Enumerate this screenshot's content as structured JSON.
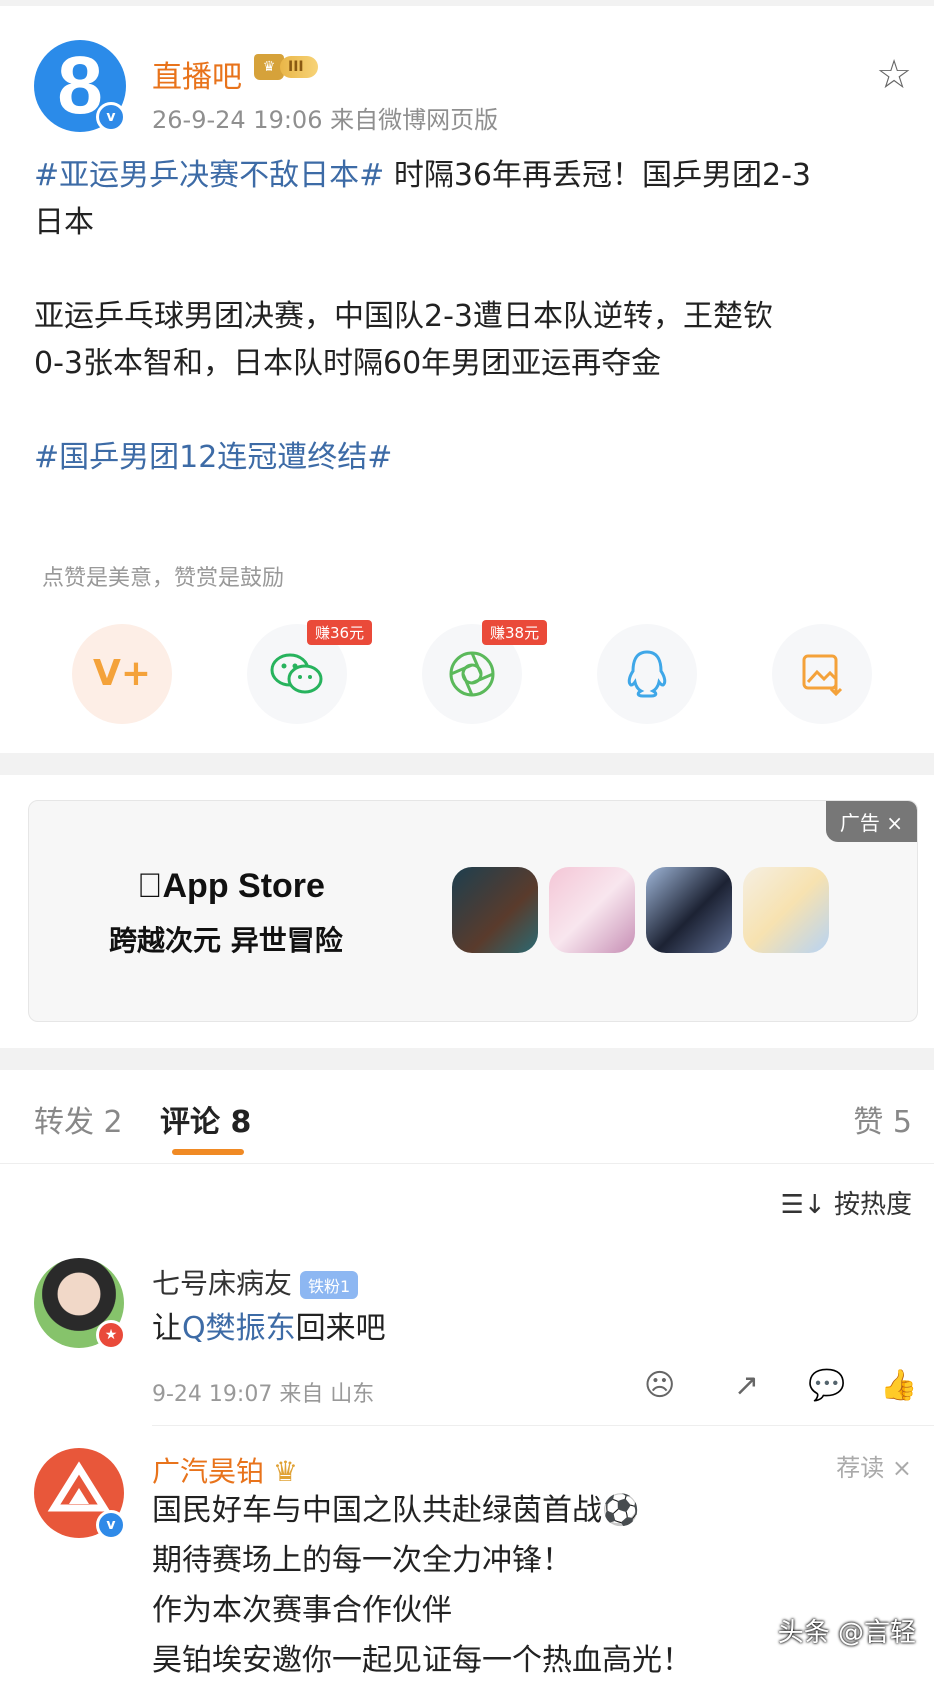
{
  "post": {
    "author": "直播吧",
    "avatar_char": "8",
    "level": "III",
    "meta": "26-9-24 19:06  来自微博网页版",
    "line1_tag": "#亚运男乒决赛不敌日本#",
    "line1_rest": " 时隔36年再丢冠！国乒男团2-3",
    "line2": "日本",
    "para2_line1": "亚运乒乓球男团决赛，中国队2-3遭日本队逆转，王楚钦",
    "para2_line2": "0-3张本智和，日本队时隔60年男团亚运再夺金",
    "tag2": "#国乒男团12连冠遭终结#",
    "reward_text": "点赞是美意，赞赏是鼓励"
  },
  "share": {
    "items": [
      {
        "name": "reward",
        "icon": "V+",
        "color": "#f4a23a"
      },
      {
        "name": "wechat",
        "icon": "wechat-icon",
        "earn": "赚36元",
        "color": "#27b35d"
      },
      {
        "name": "moments",
        "icon": "moments-icon",
        "earn": "赚38元",
        "color": "#5bb95b"
      },
      {
        "name": "qq",
        "icon": "qq-icon",
        "color": "#3fa7e8"
      },
      {
        "name": "save-image",
        "icon": "image-icon",
        "color": "#f4a23a"
      }
    ]
  },
  "ad": {
    "tag": "广告 ×",
    "brand": "App Store",
    "slogan": "跨越次元 异世冒险"
  },
  "tabs": {
    "repost": "转发 2",
    "comment": "评论 8",
    "like": "赞 5"
  },
  "sort_label": "按热度",
  "comments": [
    {
      "name": "七号床病友",
      "fan_badge": "铁粉1",
      "text_pre": "让",
      "text_link": "Q樊振东",
      "text_post": "回来吧",
      "meta": "9-24 19:07  来自 山东"
    },
    {
      "name": "广汽昊铂",
      "recommend": "荐读 ×",
      "lines": [
        "国民好车与中国之队共赴绿茵首战⚽",
        "期待赛场上的每一次全力冲锋！",
        "作为本次赛事合作伙伴",
        "昊铂埃安邀你一起见证每一个热血高光！"
      ]
    }
  ],
  "watermark": "头条 @言轻"
}
